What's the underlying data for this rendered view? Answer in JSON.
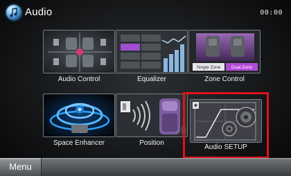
{
  "header": {
    "app_icon": "music-note-icon",
    "title": "Audio",
    "clock": "00:00"
  },
  "tiles": [
    {
      "id": "audio-control",
      "label": "Audio Control",
      "icon": "speaker-seats-icon"
    },
    {
      "id": "equalizer",
      "label": "Equalizer",
      "icon": "equalizer-icon"
    },
    {
      "id": "zone-control",
      "label": "Zone Control",
      "icon": "zone-seats-icon",
      "zone_options": [
        "Single Zone",
        "Dual Zone"
      ],
      "selected_zone": "Dual Zone"
    },
    {
      "id": "space-enhancer",
      "label": "Space Enhancer",
      "icon": "space-enhancer-icon"
    },
    {
      "id": "position",
      "label": "Position",
      "icon": "position-icon"
    },
    {
      "id": "audio-setup",
      "label": "Audio SETUP",
      "icon": "audio-setup-icon",
      "highlighted": true
    }
  ],
  "footer": {
    "menu_label": "Menu"
  },
  "colors": {
    "highlight": "#e0121c",
    "accent": "#b34ad6",
    "tile_background": "#2a2d31"
  }
}
